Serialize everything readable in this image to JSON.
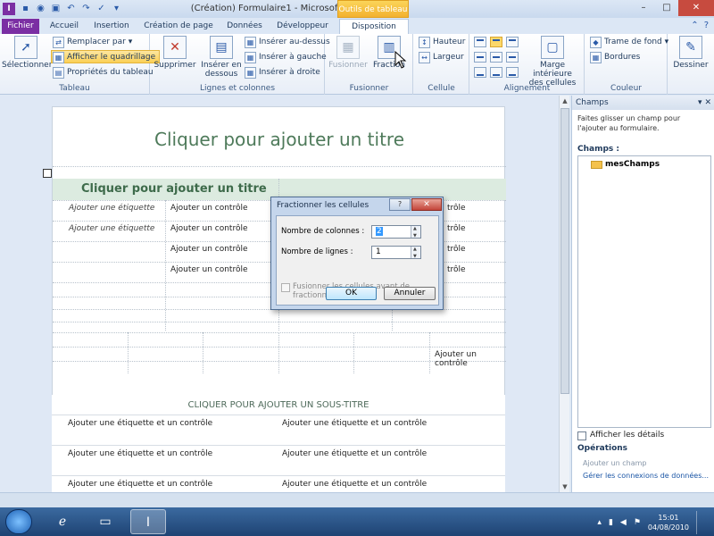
{
  "titlebar": {
    "title": "(Création) Formulaire1 - Microsoft InfoPath",
    "context_tab": "Outils de tableau",
    "minimize": "–",
    "maximize": "□",
    "close": "✕"
  },
  "tabs": {
    "file": "Fichier",
    "home": "Accueil",
    "insert": "Insertion",
    "page_design": "Création de page",
    "data": "Données",
    "developer": "Développeur",
    "layout": "Disposition"
  },
  "ribbon": {
    "tableau": {
      "label": "Tableau",
      "select": "Sélectionner",
      "replace_by": "Remplacer par",
      "show_grid": "Afficher le quadrillage",
      "table_props": "Propriétés du tableau"
    },
    "rows_cols": {
      "label": "Lignes et colonnes",
      "delete": "Supprimer",
      "insert_below_1": "Insérer en",
      "insert_below_2": "dessous",
      "insert_above": "Insérer au-dessus",
      "insert_left": "Insérer à gauche",
      "insert_right": "Insérer à droite"
    },
    "merge": {
      "label": "Fusionner",
      "merge": "Fusionner",
      "split": "Fraction"
    },
    "cell": {
      "label": "Cellule",
      "height": "Hauteur",
      "width": "Largeur"
    },
    "alignment": {
      "label": "Alignement",
      "padding_1": "Marge intérieure",
      "padding_2": "des cellules"
    },
    "color": {
      "label": "Couleur",
      "shading": "Trame de fond",
      "borders": "Bordures"
    },
    "draw": {
      "draw": "Dessiner"
    }
  },
  "form": {
    "title": "Cliquer pour ajouter un titre",
    "section_title": "Cliquer pour ajouter un titre",
    "rows": [
      {
        "label": "Ajouter une étiquette",
        "control": "Ajouter un contrôle",
        "c3": "",
        "c4": "trôle"
      },
      {
        "label": "Ajouter une étiquette",
        "control": "Ajouter un contrôle",
        "c3": "",
        "c4": "trôle"
      },
      {
        "label": "",
        "control": "Ajouter un contrôle",
        "c3": "",
        "c4": "trôle"
      },
      {
        "label": "",
        "control": "Ajouter un contrôle",
        "c3": "",
        "c4": "trôle"
      }
    ],
    "grid_last": "Ajouter un contrôle",
    "subtitle": "CLIQUER POUR AJOUTER UN SOUS-TITRE",
    "sub_rows": [
      [
        "Ajouter une étiquette et un contrôle",
        "Ajouter une étiquette et un contrôle"
      ],
      [
        "Ajouter une étiquette et un contrôle",
        "Ajouter une étiquette et un contrôle"
      ],
      [
        "Ajouter une étiquette et un contrôle",
        "Ajouter une étiquette et un contrôle"
      ]
    ]
  },
  "dialog": {
    "title": "Fractionner les cellules",
    "help": "?",
    "close": "✕",
    "columns_label": "Nombre de colonnes :",
    "columns_value": "2",
    "rows_label": "Nombre de lignes :",
    "rows_value": "1",
    "merge_checkbox": "Fusionner les cellules avant de fractionner",
    "ok": "OK",
    "cancel": "Annuler"
  },
  "pane": {
    "title": "Champs",
    "description": "Faites glisser un champ pour l'ajouter au formulaire.",
    "fields_label": "Champs :",
    "root_node": "mesChamps",
    "show_details": "Afficher les détails",
    "operations": "Opérations",
    "add_field": "Ajouter un champ",
    "manage_connections": "Gérer les connexions de données..."
  },
  "taskbar": {
    "time": "15:01",
    "date": "04/08/2010"
  },
  "colors": {
    "accent": "#7b2fa3",
    "context_tab": "#f3b12f",
    "title_green": "#4e7a5a"
  }
}
